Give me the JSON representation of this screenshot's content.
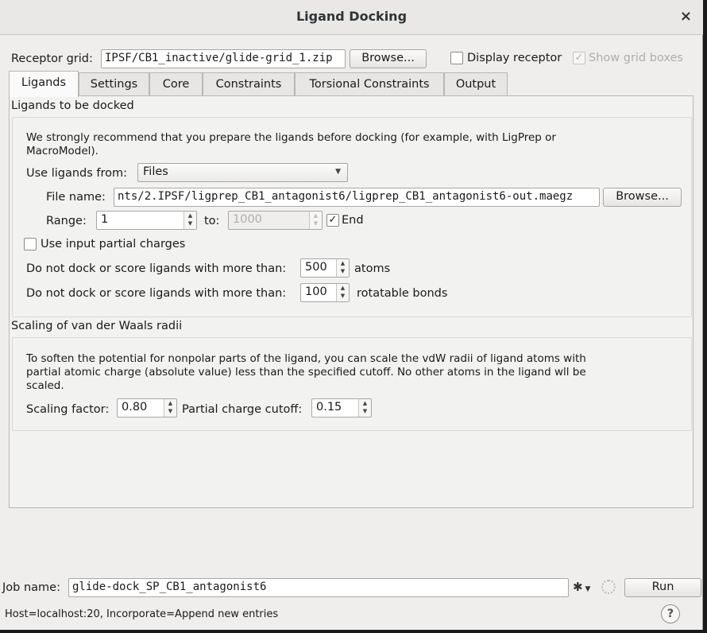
{
  "window": {
    "title": "Ligand Docking",
    "close_icon": "×"
  },
  "receptor": {
    "label": "Receptor grid:",
    "value": "IPSF/CB1_inactive/glide-grid_1.zip",
    "browse_label": "Browse...",
    "display_receptor_label": "Display receptor",
    "display_receptor_checked": false,
    "show_grid_label": "Show grid boxes",
    "show_grid_checked": true
  },
  "tabs": [
    {
      "label": "Ligands",
      "active": true
    },
    {
      "label": "Settings"
    },
    {
      "label": "Core"
    },
    {
      "label": "Constraints"
    },
    {
      "label": "Torsional Constraints"
    },
    {
      "label": "Output"
    }
  ],
  "ligands_section": {
    "title": "Ligands to be docked",
    "recommend_line1": "We strongly recommend that you prepare the ligands before docking (for example, with LigPrep or",
    "recommend_line2": "MacroModel).",
    "use_from_label": "Use ligands from:",
    "use_from_value": "Files",
    "file_name_label": "File name:",
    "file_name_value": "nts/2.IPSF/ligprep_CB1_antagonist6/ligprep_CB1_antagonist6-out.maegz",
    "file_browse_label": "Browse...",
    "range_label": "Range:",
    "range_from": "1",
    "range_to_label": "to:",
    "range_to": "1000",
    "end_label": "End",
    "end_checked": true,
    "partial_charges_label": "Use input partial charges",
    "partial_charges_checked": false,
    "atoms_prefix": "Do not dock or score ligands with more than:",
    "atoms_value": "500",
    "atoms_suffix": "atoms",
    "bonds_prefix": "Do not dock or score ligands with more than:",
    "bonds_value": "100",
    "bonds_suffix": "rotatable bonds"
  },
  "vdw_section": {
    "title": "Scaling of van der Waals radii",
    "desc_line1": "To soften the potential for nonpolar parts of the ligand, you can scale the vdW radii of ligand atoms with",
    "desc_line2": "partial atomic charge (absolute value) less than the specified cutoff. No other atoms in the ligand wll be",
    "desc_line3": "scaled.",
    "scaling_label": "Scaling factor:",
    "scaling_value": "0.80",
    "cutoff_label": "Partial charge cutoff:",
    "cutoff_value": "0.15"
  },
  "job": {
    "label": "Job name:",
    "value": "glide-dock_SP_CB1_antagonist6",
    "gear_icon": "✱",
    "run_label": "Run",
    "status": "Host=localhost:20, Incorporate=Append new entries",
    "help_label": "?"
  }
}
